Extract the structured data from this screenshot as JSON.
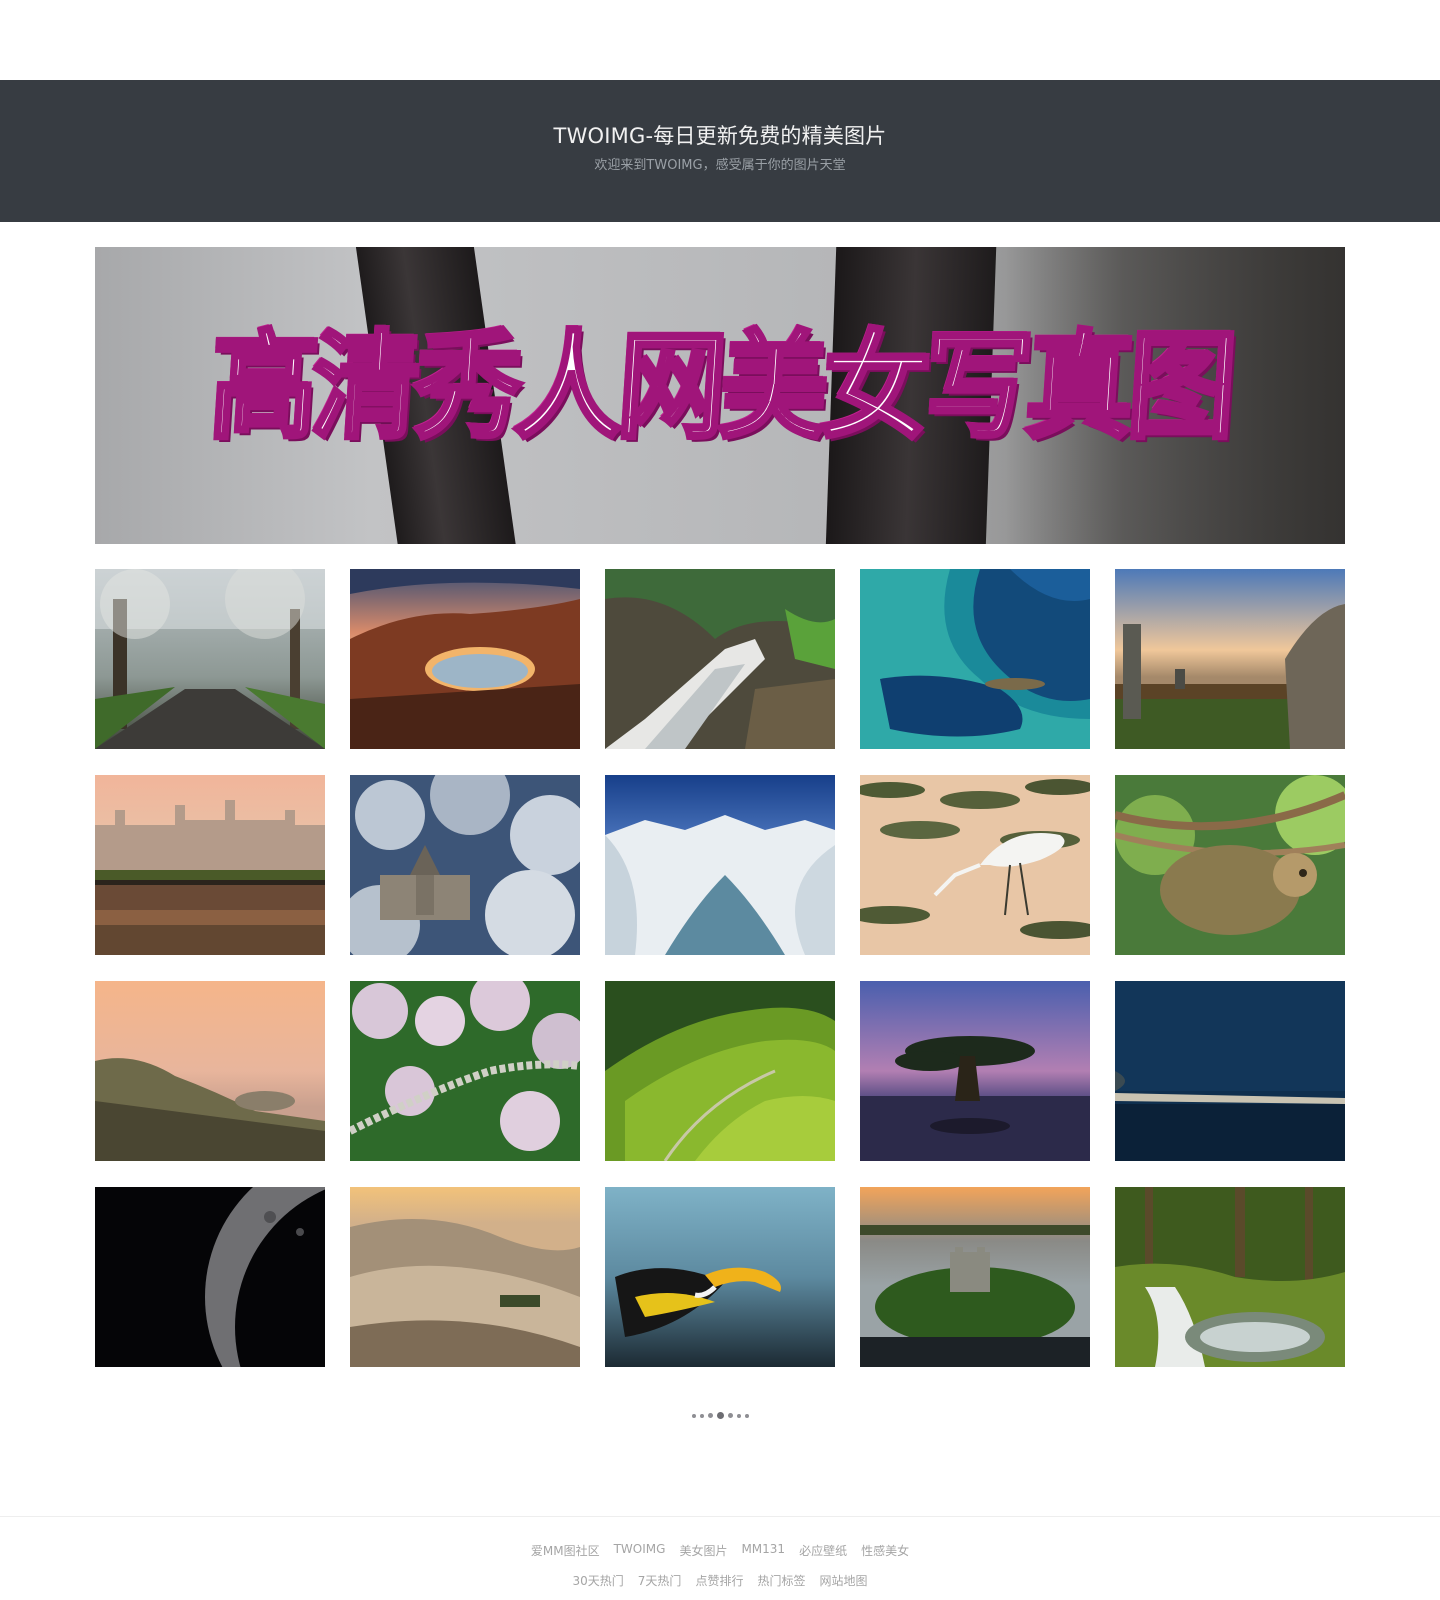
{
  "header": {
    "title": "TWOIMG-每日更新免费的精美图片",
    "tagline": "欢迎来到TWOIMG，感受属于你的图片天堂"
  },
  "banner": {
    "text": "高清秀人网美女写真图"
  },
  "gallery": {
    "items": [
      {
        "subject": "misty-forest-road"
      },
      {
        "subject": "red-rock-arch"
      },
      {
        "subject": "waterfall-aerial"
      },
      {
        "subject": "ocean-reef-aerial"
      },
      {
        "subject": "standing-stones-sunset"
      },
      {
        "subject": "chateau-reflection"
      },
      {
        "subject": "snowy-church"
      },
      {
        "subject": "glacier-lake"
      },
      {
        "subject": "egret-lily-pads"
      },
      {
        "subject": "sloth-on-branch"
      },
      {
        "subject": "coastal-sunset"
      },
      {
        "subject": "cherry-blossom-trail"
      },
      {
        "subject": "tea-plantation"
      },
      {
        "subject": "lone-tree-dusk"
      },
      {
        "subject": "night-lake-shore"
      },
      {
        "subject": "moon-crescent"
      },
      {
        "subject": "desert-dunes"
      },
      {
        "subject": "hornbill-flight"
      },
      {
        "subject": "castle-island"
      },
      {
        "subject": "forest-waterfall"
      }
    ]
  },
  "pagination": {
    "dots": 7,
    "active_index": 3
  },
  "footer": {
    "row1": [
      "爱MM图社区",
      "TWOIMG",
      "美女图片",
      "MM131",
      "必应壁纸",
      "性感美女"
    ],
    "row2": [
      "30天热门",
      "7天热门",
      "点赞排行",
      "热门标签",
      "网站地图"
    ]
  },
  "colors": {
    "header_bg": "#373c42",
    "banner_stroke": "#a0157a",
    "footer_text": "#a5a5a5"
  }
}
